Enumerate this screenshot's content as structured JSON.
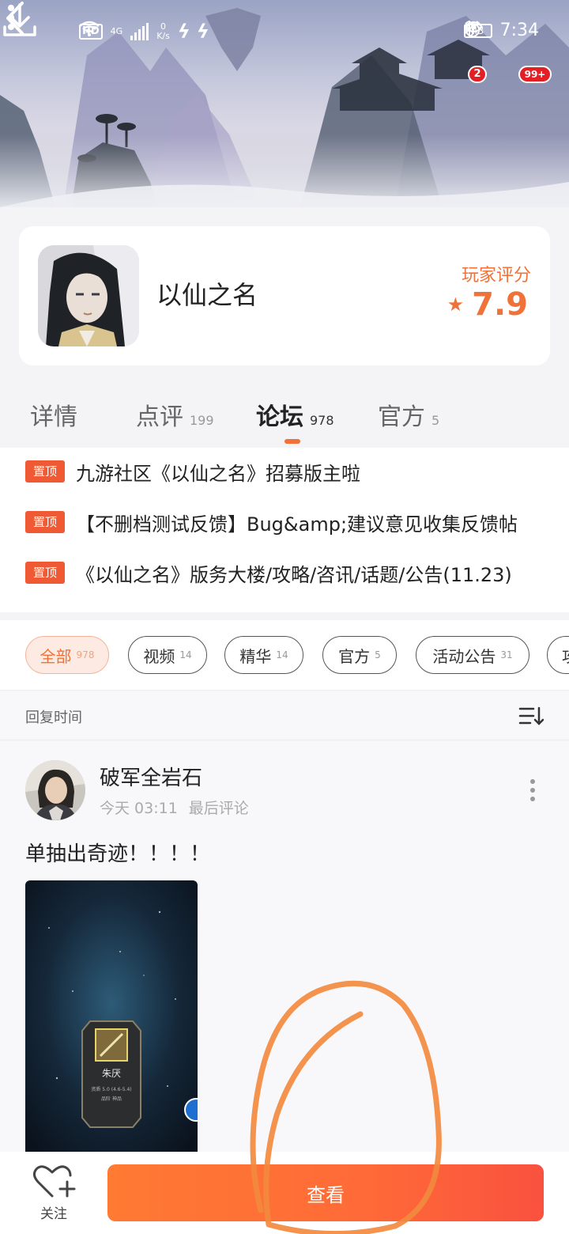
{
  "status_bar": {
    "hd": "HD",
    "network": "4G",
    "speed_value": "0",
    "speed_unit": "K/s",
    "battery": "43",
    "time": "7:34"
  },
  "header": {
    "download_badge": "2",
    "more_badge": "99+"
  },
  "game": {
    "name": "以仙之名",
    "rating_label": "玩家评分",
    "rating": "7.9"
  },
  "tabs": [
    {
      "label": "详情",
      "count": ""
    },
    {
      "label": "点评",
      "count": "199"
    },
    {
      "label": "论坛",
      "count": "978",
      "active": true
    },
    {
      "label": "官方",
      "count": "5"
    }
  ],
  "pinned": {
    "tag": "置顶",
    "items": [
      "九游社区《以仙之名》招募版主啦",
      "【不删档测试反馈】Bug&amp;建议意见收集反馈帖",
      "《以仙之名》版务大楼/攻略/咨讯/话题/公告(11.23)"
    ]
  },
  "filters": [
    {
      "label": "全部",
      "count": "978",
      "active": true
    },
    {
      "label": "视频",
      "count": "14"
    },
    {
      "label": "精华",
      "count": "14"
    },
    {
      "label": "官方",
      "count": "5"
    },
    {
      "label": "活动公告",
      "count": "31"
    },
    {
      "label": "攻",
      "count": ""
    }
  ],
  "sort": {
    "label": "回复时间"
  },
  "post": {
    "author": "破军全岩石",
    "time": "今天 03:11",
    "action": "最后评论",
    "body": "单抽出奇迹！！！！",
    "image": {
      "card_name": "朱厌",
      "card_info": "资质 5.0 (4.6-5.4)",
      "card_sub": "品阶 神品"
    }
  },
  "bottom": {
    "follow_label": "关注",
    "view_label": "查看"
  },
  "colors": {
    "accent": "#f07238",
    "button_start": "#ff7a33",
    "button_end": "#f9513f",
    "pin_tag": "#ef5a34",
    "annotation_stroke": "#f28a3e"
  }
}
